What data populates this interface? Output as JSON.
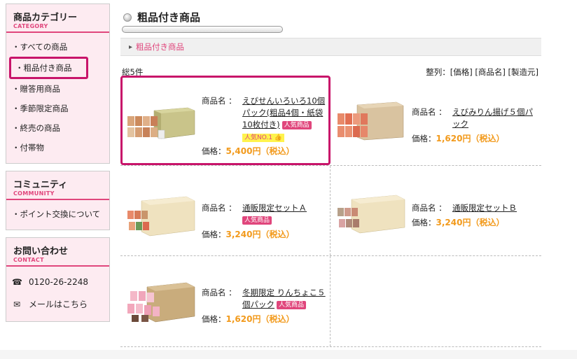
{
  "sidebar": {
    "category": {
      "title": "商品カテゴリー",
      "subtitle": "CATEGORY",
      "items": [
        {
          "label": "・すべての商品"
        },
        {
          "label": "・粗品付き商品"
        },
        {
          "label": "・贈答用商品"
        },
        {
          "label": "・季節限定商品"
        },
        {
          "label": "・終売の商品"
        },
        {
          "label": "・付帯物"
        }
      ]
    },
    "community": {
      "title": "コミュニティ",
      "subtitle": "COMMUNITY",
      "items": [
        {
          "label": "・ポイント交換について"
        }
      ]
    },
    "contact": {
      "title": "お問い合わせ",
      "subtitle": "CONTACT",
      "phone_icon": "☎",
      "phone": "0120-26-2248",
      "mail_icon": "✉",
      "mail_label": "メールはこちら"
    }
  },
  "main": {
    "title": "粗品付き商品",
    "breadcrumb": "粗品付き商品",
    "count": "総5件",
    "sort": {
      "prefix": "整列：",
      "price": "[価格]",
      "name": "[商品名]",
      "maker": "[製造元]"
    },
    "name_label": "商品名 ：",
    "price_label": "価格：",
    "products": [
      {
        "name": "えびせんいろいろ10個パック(粗品4個・紙袋10枚付き)",
        "badge": "人気商品",
        "no1": "人気NO.1 👍",
        "price": "5,400円（税込）"
      },
      {
        "name": "えびみりん揚げ５個パック",
        "price": "1,620円（税込）"
      },
      {
        "name": "通販限定セットＡ",
        "badge": "人気商品",
        "price": "3,240円（税込）"
      },
      {
        "name": "通販限定セットＢ",
        "price": "3,240円（税込）"
      },
      {
        "name": "冬期限定 りんちょこ５個パック",
        "badge": "人気商品",
        "price": "1,620円（税込）"
      }
    ]
  },
  "colors": {
    "accent": "#e0467c",
    "highlight": "#c8146a",
    "price": "#f29a1c",
    "sidebar_bg": "#fdebf1"
  }
}
